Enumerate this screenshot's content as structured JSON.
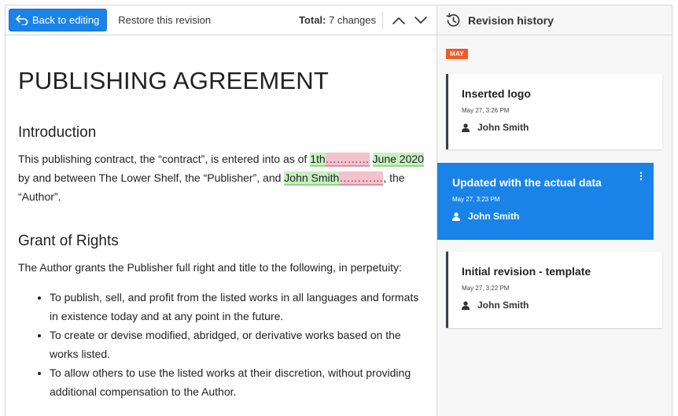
{
  "toolbar": {
    "back_label": "Back to editing",
    "restore_label": "Restore this revision",
    "total_label": "Total:",
    "total_value": "7 changes"
  },
  "document": {
    "title": "PUBLISHING AGREEMENT",
    "intro_heading": "Introduction",
    "intro_text_1": "This publishing contract, the “contract”, is entered into as of ",
    "intro_ins_1": "1th",
    "intro_del_1": "…………",
    "intro_space": " ",
    "intro_ins_2": "June 2020",
    "intro_text_2": " by and between The Lower Shelf, the “Publisher”, and ",
    "intro_ins_3": "John Smith",
    "intro_del_2": "…………",
    "intro_text_3": ", the “Author”.",
    "grant_heading": "Grant of Rights",
    "grant_text": "The Author grants the Publisher full right and title to the following, in perpetuity:",
    "rights": [
      "To publish, sell, and profit from the listed works in all languages and formats in existence today and at any point in the future.",
      "To create or devise modified, abridged, or derivative works based on the works listed.",
      "To allow others to use the listed works at their discretion, without providing additional compensation to the Author."
    ]
  },
  "history": {
    "header": "Revision history",
    "month": "MAY",
    "revisions": [
      {
        "title": "Inserted logo",
        "date": "May 27, 3:26 PM",
        "author": "John Smith"
      },
      {
        "title": "Updated with the actual data",
        "date": "May 27, 3:23 PM",
        "author": "John Smith"
      },
      {
        "title": "Initial revision - template",
        "date": "May 27, 3:22 PM",
        "author": "John Smith"
      }
    ]
  },
  "colors": {
    "accent": "#1a83e8",
    "month_badge": "#f15a24",
    "insertion": "#c7efc0",
    "deletion": "#f3c2cc"
  },
  "icons": {
    "back": "undo-arrow-icon",
    "prev": "chevron-up-icon",
    "next": "chevron-down-icon",
    "history": "history-clock-icon",
    "author": "user-icon",
    "menu": "kebab-menu-icon"
  }
}
